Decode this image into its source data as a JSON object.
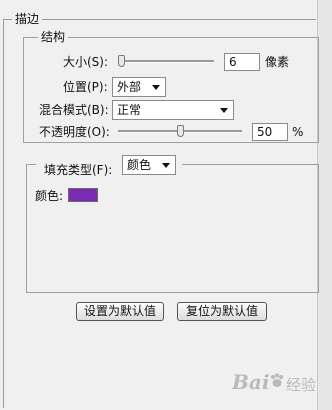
{
  "dialog": {
    "section_title": "描边",
    "structure": {
      "title": "结构",
      "size_label": "大小(S):",
      "size_value": "6",
      "size_unit": "像素",
      "position_label": "位置(P):",
      "position_value": "外部",
      "blend_label": "混合模式(B):",
      "blend_value": "正常",
      "opacity_label": "不透明度(O):",
      "opacity_value": "50",
      "opacity_unit": "%",
      "size_slider_fraction": 0.0,
      "opacity_slider_fraction": 0.5
    },
    "fill": {
      "type_label": "填充类型(F):",
      "type_value": "颜色",
      "color_label": "颜色:",
      "color_hex": "#7a2ab3"
    },
    "buttons": {
      "make_default": "设置为默认值",
      "reset_default": "复位为默认值"
    }
  },
  "watermark": {
    "brand": "Bai",
    "brand_cn": "经验",
    "icon": "paw-icon"
  }
}
